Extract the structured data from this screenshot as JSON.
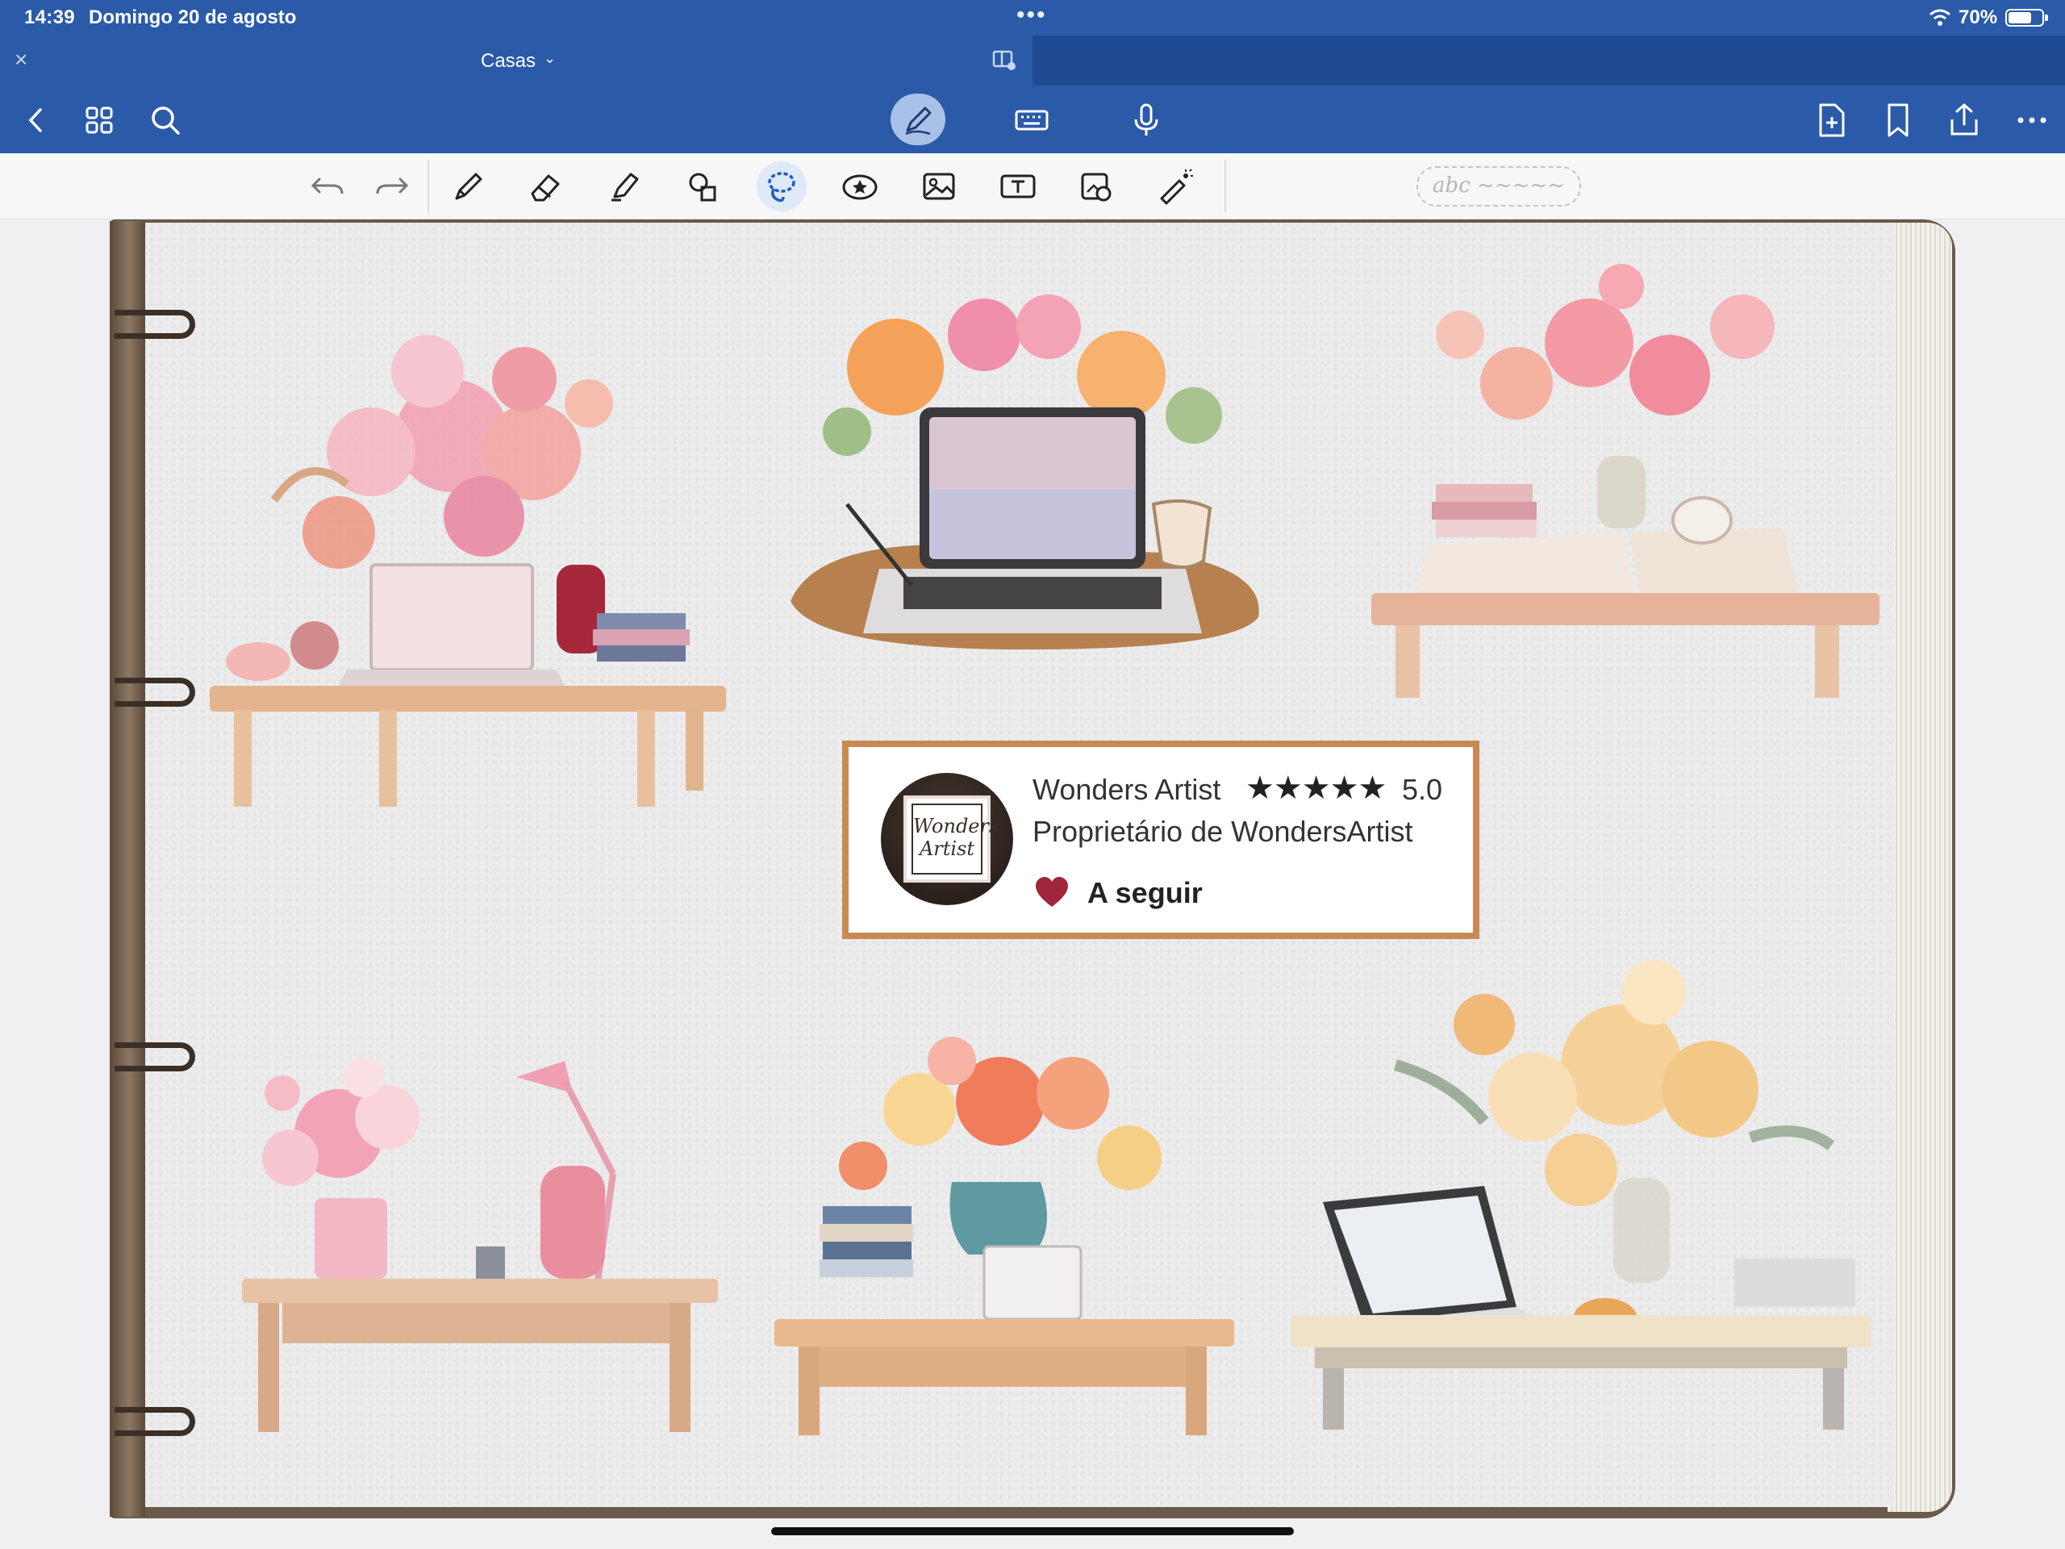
{
  "status_bar": {
    "time": "14:39",
    "date": "Domingo 20 de agosto",
    "more_dots": "•••",
    "battery_percent": "70%",
    "battery_level": 0.7
  },
  "tab": {
    "title": "Casas",
    "close_glyph": "×",
    "chevron_glyph": "⌄"
  },
  "nav_icons": [
    "back-icon",
    "grid-icon",
    "search-icon",
    "pen-mode-icon",
    "keyboard-icon",
    "microphone-icon",
    "add-page-icon",
    "bookmark-icon",
    "share-icon",
    "more-icon"
  ],
  "tools": [
    "undo-icon",
    "redo-icon",
    "pen-icon",
    "eraser-icon",
    "highlighter-icon",
    "shapes-icon",
    "lasso-icon",
    "sticker-icon",
    "image-icon",
    "text-icon",
    "camera-icon",
    "laser-pointer-icon"
  ],
  "handwriting_box": "abc ~~~~~",
  "shop_card": {
    "name": "Wonders Artist",
    "stars": "★★★★★",
    "rating": "5.0",
    "owner": "Proprietário de WondersArtist",
    "follow": "A seguir",
    "logo_text_line1": "Wonders",
    "logo_text_line2": "Artist"
  },
  "colors": {
    "accent": "#2b5aa8",
    "card_border": "#c98a52",
    "heart": "#a0263c"
  }
}
